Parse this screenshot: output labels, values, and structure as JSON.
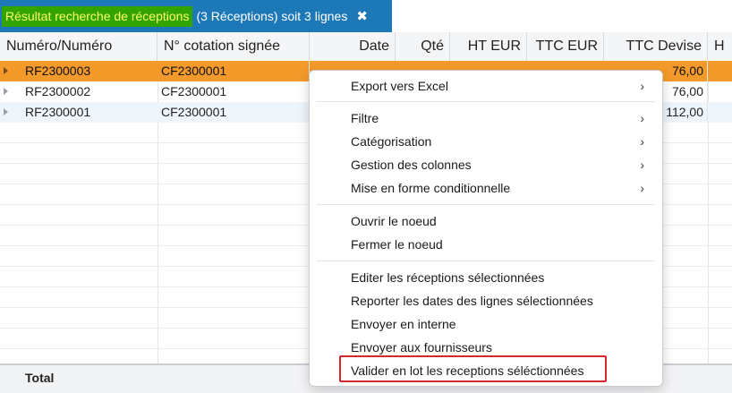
{
  "tab": {
    "highlight_text": "Résultat recherche de réceptions",
    "rest_text": "(3 Réceptions) soit 3 lignes",
    "close_glyph": "✖"
  },
  "columns": [
    {
      "label": "Numéro/Numéro"
    },
    {
      "label": "N° cotation signée"
    },
    {
      "label": "Date"
    },
    {
      "label": "Qté"
    },
    {
      "label": "HT EUR"
    },
    {
      "label": "TTC EUR"
    },
    {
      "label": "TTC Devise"
    },
    {
      "label": "H"
    }
  ],
  "rows": [
    {
      "numero": "RF2300003",
      "cotation": "CF2300001",
      "ttc_devise": "76,00",
      "selected": true
    },
    {
      "numero": "RF2300002",
      "cotation": "CF2300001",
      "ttc_devise": "76,00",
      "selected": false
    },
    {
      "numero": "RF2300001",
      "cotation": "CF2300001",
      "ttc_devise": "112,00",
      "selected": false
    }
  ],
  "total": {
    "label": "Total"
  },
  "context_menu": {
    "items": [
      {
        "label": "Export vers Excel",
        "submenu": true
      },
      {
        "label": "Filtre",
        "submenu": true
      },
      {
        "label": "Catégorisation",
        "submenu": true
      },
      {
        "label": "Gestion des colonnes",
        "submenu": true
      },
      {
        "label": "Mise en forme conditionnelle",
        "submenu": true
      },
      {
        "label": "Ouvrir le noeud",
        "submenu": false
      },
      {
        "label": "Fermer le noeud",
        "submenu": false
      },
      {
        "label": "Editer les réceptions sélectionnées",
        "submenu": false
      },
      {
        "label": "Reporter les dates des lignes sélectionnées",
        "submenu": false
      },
      {
        "label": "Envoyer en interne",
        "submenu": false
      },
      {
        "label": "Envoyer aux fournisseurs",
        "submenu": false
      },
      {
        "label": "Valider en lot les receptions séléctionnées",
        "submenu": false
      }
    ],
    "submenu_glyph": "›"
  },
  "colors": {
    "tab": "#1d78b8",
    "tab_highlight": "#33a300",
    "tab_highlight_text": "#ffff66",
    "selected_row": "#f39a2b",
    "callout": "#d9262b"
  }
}
